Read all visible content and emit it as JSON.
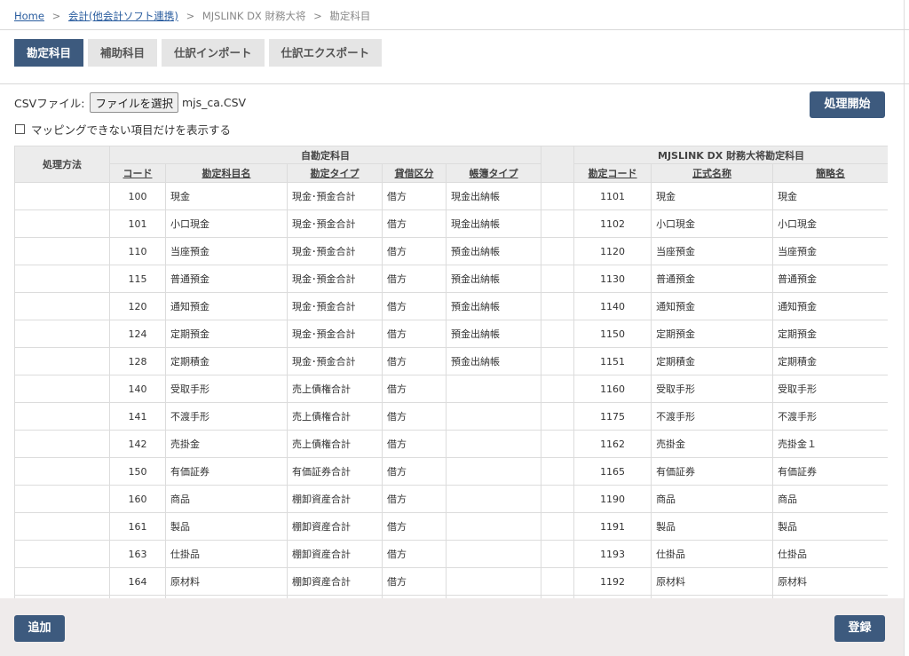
{
  "breadcrumb": {
    "home": "Home",
    "sep": ">",
    "parent": "会計(他会計ソフト連携)",
    "middle": "MJSLINK DX 財務大将",
    "current": "勘定科目"
  },
  "tabs": [
    "勘定科目",
    "補助科目",
    "仕訳インポート",
    "仕訳エクスポート"
  ],
  "active_tab": "勘定科目",
  "csv": {
    "label": "CSVファイル:",
    "button": "ファイルを選択",
    "file_name": "mjs_ca.CSV"
  },
  "filter": {
    "label": "マッピングできない項目だけを表示する",
    "checked": false
  },
  "buttons": {
    "start": "処理開始",
    "add": "追加",
    "register": "登録"
  },
  "table": {
    "method_header": "処理方法",
    "own_group": "自勘定科目",
    "mjs_group": "MJSLINK DX 財務大将勘定科目",
    "own_columns": [
      "コード",
      "勘定科目名",
      "勘定タイプ",
      "貸借区分",
      "帳簿タイプ"
    ],
    "mjs_columns": [
      "勘定コード",
      "正式名称",
      "簡略名"
    ],
    "rows": [
      {
        "method": "",
        "code": "100",
        "name": "現金",
        "type": "現金･預金合計",
        "side": "借方",
        "book": "現金出納帳",
        "mjs_code": "1101",
        "official": "現金",
        "short": "現金"
      },
      {
        "method": "",
        "code": "101",
        "name": "小口現金",
        "type": "現金･預金合計",
        "side": "借方",
        "book": "現金出納帳",
        "mjs_code": "1102",
        "official": "小口現金",
        "short": "小口現金"
      },
      {
        "method": "",
        "code": "110",
        "name": "当座預金",
        "type": "現金･預金合計",
        "side": "借方",
        "book": "預金出納帳",
        "mjs_code": "1120",
        "official": "当座預金",
        "short": "当座預金"
      },
      {
        "method": "",
        "code": "115",
        "name": "普通預金",
        "type": "現金･預金合計",
        "side": "借方",
        "book": "預金出納帳",
        "mjs_code": "1130",
        "official": "普通預金",
        "short": "普通預金"
      },
      {
        "method": "",
        "code": "120",
        "name": "通知預金",
        "type": "現金･預金合計",
        "side": "借方",
        "book": "預金出納帳",
        "mjs_code": "1140",
        "official": "通知預金",
        "short": "通知預金"
      },
      {
        "method": "",
        "code": "124",
        "name": "定期預金",
        "type": "現金･預金合計",
        "side": "借方",
        "book": "預金出納帳",
        "mjs_code": "1150",
        "official": "定期預金",
        "short": "定期預金"
      },
      {
        "method": "",
        "code": "128",
        "name": "定期積金",
        "type": "現金･預金合計",
        "side": "借方",
        "book": "預金出納帳",
        "mjs_code": "1151",
        "official": "定期積金",
        "short": "定期積金"
      },
      {
        "method": "",
        "code": "140",
        "name": "受取手形",
        "type": "売上債権合計",
        "side": "借方",
        "book": "",
        "mjs_code": "1160",
        "official": "受取手形",
        "short": "受取手形"
      },
      {
        "method": "",
        "code": "141",
        "name": "不渡手形",
        "type": "売上債権合計",
        "side": "借方",
        "book": "",
        "mjs_code": "1175",
        "official": "不渡手形",
        "short": "不渡手形"
      },
      {
        "method": "",
        "code": "142",
        "name": "売掛金",
        "type": "売上債権合計",
        "side": "借方",
        "book": "",
        "mjs_code": "1162",
        "official": "売掛金",
        "short": "売掛金１"
      },
      {
        "method": "",
        "code": "150",
        "name": "有価証券",
        "type": "有価証券合計",
        "side": "借方",
        "book": "",
        "mjs_code": "1165",
        "official": "有価証券",
        "short": "有価証券"
      },
      {
        "method": "",
        "code": "160",
        "name": "商品",
        "type": "棚卸資産合計",
        "side": "借方",
        "book": "",
        "mjs_code": "1190",
        "official": "商品",
        "short": "商品"
      },
      {
        "method": "",
        "code": "161",
        "name": "製品",
        "type": "棚卸資産合計",
        "side": "借方",
        "book": "",
        "mjs_code": "1191",
        "official": "製品",
        "short": "製品"
      },
      {
        "method": "",
        "code": "163",
        "name": "仕掛品",
        "type": "棚卸資産合計",
        "side": "借方",
        "book": "",
        "mjs_code": "1193",
        "official": "仕掛品",
        "short": "仕掛品"
      },
      {
        "method": "",
        "code": "164",
        "name": "原材料",
        "type": "棚卸資産合計",
        "side": "借方",
        "book": "",
        "mjs_code": "1192",
        "official": "原材料",
        "short": "原材料"
      },
      {
        "method": "",
        "code": "",
        "name": "",
        "type": "",
        "side": "",
        "book": "",
        "mjs_code": "",
        "official": "",
        "short": ""
      }
    ]
  }
}
